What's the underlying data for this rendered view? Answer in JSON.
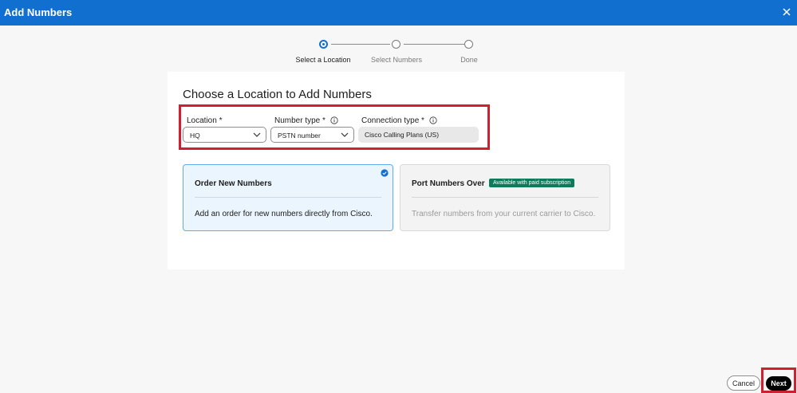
{
  "window": {
    "title": "Add Numbers"
  },
  "stepper": {
    "steps": [
      {
        "label": "Select a Location"
      },
      {
        "label": "Select Numbers"
      },
      {
        "label": "Done"
      }
    ]
  },
  "form": {
    "heading": "Choose a Location to Add Numbers",
    "location": {
      "label": "Location *",
      "value": "HQ"
    },
    "number_type": {
      "label": "Number type *",
      "value": "PSTN number"
    },
    "connection_type": {
      "label": "Connection type *",
      "value": "Cisco Calling Plans (US)"
    }
  },
  "options": [
    {
      "title": "Order New Numbers",
      "description": "Add an order for new numbers directly from Cisco."
    },
    {
      "title": "Port Numbers Over",
      "badge": "Available with paid subscription",
      "description": "Transfer numbers from your current carrier to Cisco."
    }
  ],
  "footer": {
    "cancel_label": "Cancel",
    "next_label": "Next"
  },
  "colors": {
    "header": "#1170cf",
    "highlight": "#d01f2e",
    "badge": "#0e7c5b",
    "selected_border": "#62abe8"
  }
}
